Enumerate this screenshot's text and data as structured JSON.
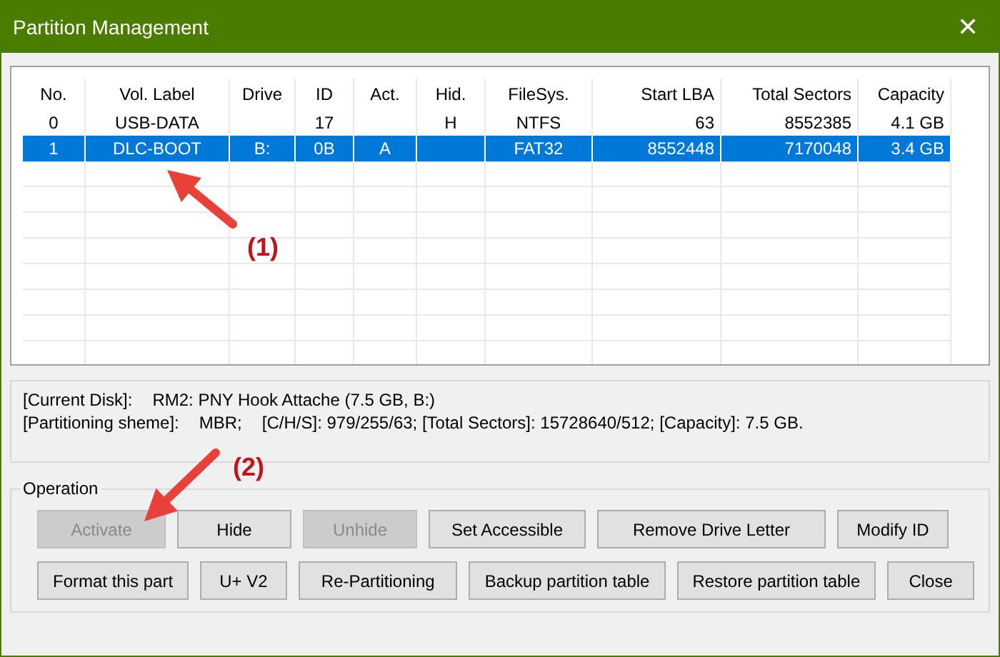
{
  "window": {
    "title": "Partition Management",
    "close": "✕"
  },
  "table": {
    "columns": [
      "No.",
      "Vol. Label",
      "Drive",
      "ID",
      "Act.",
      "Hid.",
      "FileSys.",
      "Start LBA",
      "Total Sectors",
      "Capacity"
    ],
    "rows": [
      {
        "selected": false,
        "cells": [
          "0",
          "USB-DATA",
          "",
          "17",
          "",
          "H",
          "NTFS",
          "63",
          "8552385",
          "4.1 GB"
        ]
      },
      {
        "selected": true,
        "cells": [
          "1",
          "DLC-BOOT",
          "B:",
          "0B",
          "A",
          "",
          "FAT32",
          "8552448",
          "7170048",
          "3.4 GB"
        ]
      }
    ]
  },
  "disk_info": [
    {
      "parts": [
        "[Current Disk]:",
        "RM2: PNY Hook Attache (7.5 GB, B:)"
      ]
    },
    {
      "parts": [
        "[Partitioning sheme]:",
        "MBR;",
        "[C/H/S]: 979/255/63; [Total Sectors]: 15728640/512; [Capacity]: 7.5 GB."
      ]
    }
  ],
  "operation": {
    "title": "Operation",
    "button_rows": [
      [
        {
          "label": "Activate",
          "disabled": true
        },
        {
          "label": "Hide",
          "disabled": false
        },
        {
          "label": "Unhide",
          "disabled": true
        },
        {
          "label": "Set Accessible",
          "disabled": false
        },
        {
          "label": "Remove Drive Letter",
          "disabled": false
        },
        {
          "label": "Modify ID",
          "disabled": false
        }
      ],
      [
        {
          "label": "Format this part",
          "disabled": false
        },
        {
          "label": "U+ V2",
          "disabled": false
        },
        {
          "label": "Re-Partitioning",
          "disabled": false
        },
        {
          "label": "Backup partition table",
          "disabled": false
        },
        {
          "label": "Restore partition table",
          "disabled": false
        },
        {
          "label": "Close",
          "disabled": false
        }
      ]
    ]
  },
  "annotations": [
    {
      "label": "(1)"
    },
    {
      "label": "(2)"
    }
  ]
}
